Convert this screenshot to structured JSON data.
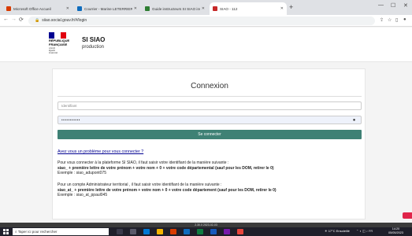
{
  "browser": {
    "tabs": [
      {
        "label": "Microsoft Office Accueil",
        "color": "#d83b01"
      },
      {
        "label": "Courrier - Marine LETERRIER - O",
        "color": "#0f6cbd"
      },
      {
        "label": "Guide instructeurs SI SIAO insc",
        "color": "#2e7d32"
      },
      {
        "label": "SIAO - 112",
        "color": "#c62828"
      }
    ],
    "new_tab": "+",
    "url": "siiao.social.gouv.fr/#/login"
  },
  "header": {
    "rf_text": "RÉPUBLIQUE FRANÇAISE",
    "rf_motto": "Liberté Égalité Fraternité",
    "title": "SI SIAO",
    "env": "production"
  },
  "login": {
    "title": "Connexion",
    "identifier_placeholder": "Identifiant",
    "password_value": "•••••••••••",
    "submit_label": "Se connecter",
    "help_link": "Avez vous un problème pour vous connecter ?",
    "info1": {
      "line1": "Pour vous connecter à la plateforme SI SIAO, il faut saisir votre identifiant de la manière suivante :",
      "line2": "siao_ + première lettre de votre prénom + votre nom + 0 + votre code départemental (sauf pour les DOM, retirer le 0)",
      "line3": "Exemple : siao_adupont075"
    },
    "info2": {
      "line1": "Pour un compte Administrateur territorial , il faut saisir votre identifiant de la manière suivante :",
      "line2": "siao_at_ + première lettre de votre prénom + votre nom + 0 + votre code département (sauf pour les DOM, retirer le 0)",
      "line3": "Exemple : siao_at_ppaul045"
    }
  },
  "footer": {
    "version": "2.30.0 2023-02-03"
  },
  "taskbar": {
    "search_placeholder": "Taper ici pour rechercher",
    "weather": "17°C Ensoleillé",
    "time": "14:20",
    "date": "05/05/2023"
  }
}
